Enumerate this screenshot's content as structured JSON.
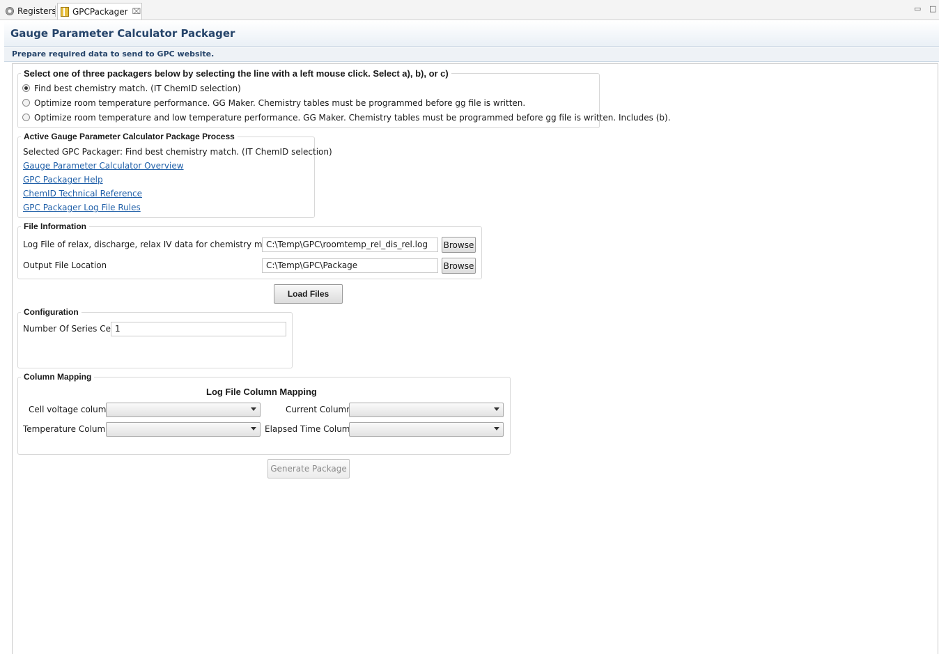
{
  "tabs": [
    {
      "label": "Registers",
      "icon": "gear-icon"
    },
    {
      "label": "GPCPackager",
      "icon": "package-icon",
      "close": "⌧"
    }
  ],
  "window_controls": {
    "minimize": "▭",
    "maximize": "□"
  },
  "header": {
    "title": "Gauge Parameter Calculator Packager"
  },
  "subheader": {
    "text": "Prepare required data to send to GPC website."
  },
  "packager_select": {
    "legend": "Select one of three packagers below by selecting the line with a left mouse click.  Select a), b), or c)",
    "options": [
      {
        "label": "Find best chemistry match. (IT ChemID selection)",
        "selected": true
      },
      {
        "label": "Optimize room temperature performance. GG Maker. Chemistry tables must be programmed before gg file is written.",
        "selected": false
      },
      {
        "label": "Optimize room temperature and low temperature performance. GG Maker. Chemistry tables must be programmed before gg file is written. Includes (b).",
        "selected": false
      }
    ]
  },
  "active_process": {
    "legend": "Active Gauge Parameter Calculator Package Process",
    "selected_text": "Selected GPC Packager:  Find best chemistry match. (IT ChemID selection)",
    "links": [
      "Gauge Parameter Calculator Overview",
      "GPC Packager Help",
      "ChemID Technical Reference",
      "GPC Packager Log File Rules"
    ]
  },
  "file_info": {
    "legend": "File Information",
    "log_label": "Log File of relax, discharge, relax IV data for chemistry matching.",
    "log_value": "C:\\Temp\\GPC\\roomtemp_rel_dis_rel.log",
    "output_label": "Output File Location",
    "output_value": "C:\\Temp\\GPC\\Package",
    "browse_label": "Browse"
  },
  "load_button": "Load Files",
  "configuration": {
    "legend": "Configuration",
    "series_label": "Number Of Series Cells",
    "series_value": "1"
  },
  "column_mapping": {
    "legend": "Column Mapping",
    "title": "Log File Column Mapping",
    "cell_voltage_label": "Cell voltage column",
    "current_label": "Current Column",
    "temperature_label": "Temperature Column",
    "elapsed_label": "Elapsed Time Column"
  },
  "generate_button": "Generate Package"
}
